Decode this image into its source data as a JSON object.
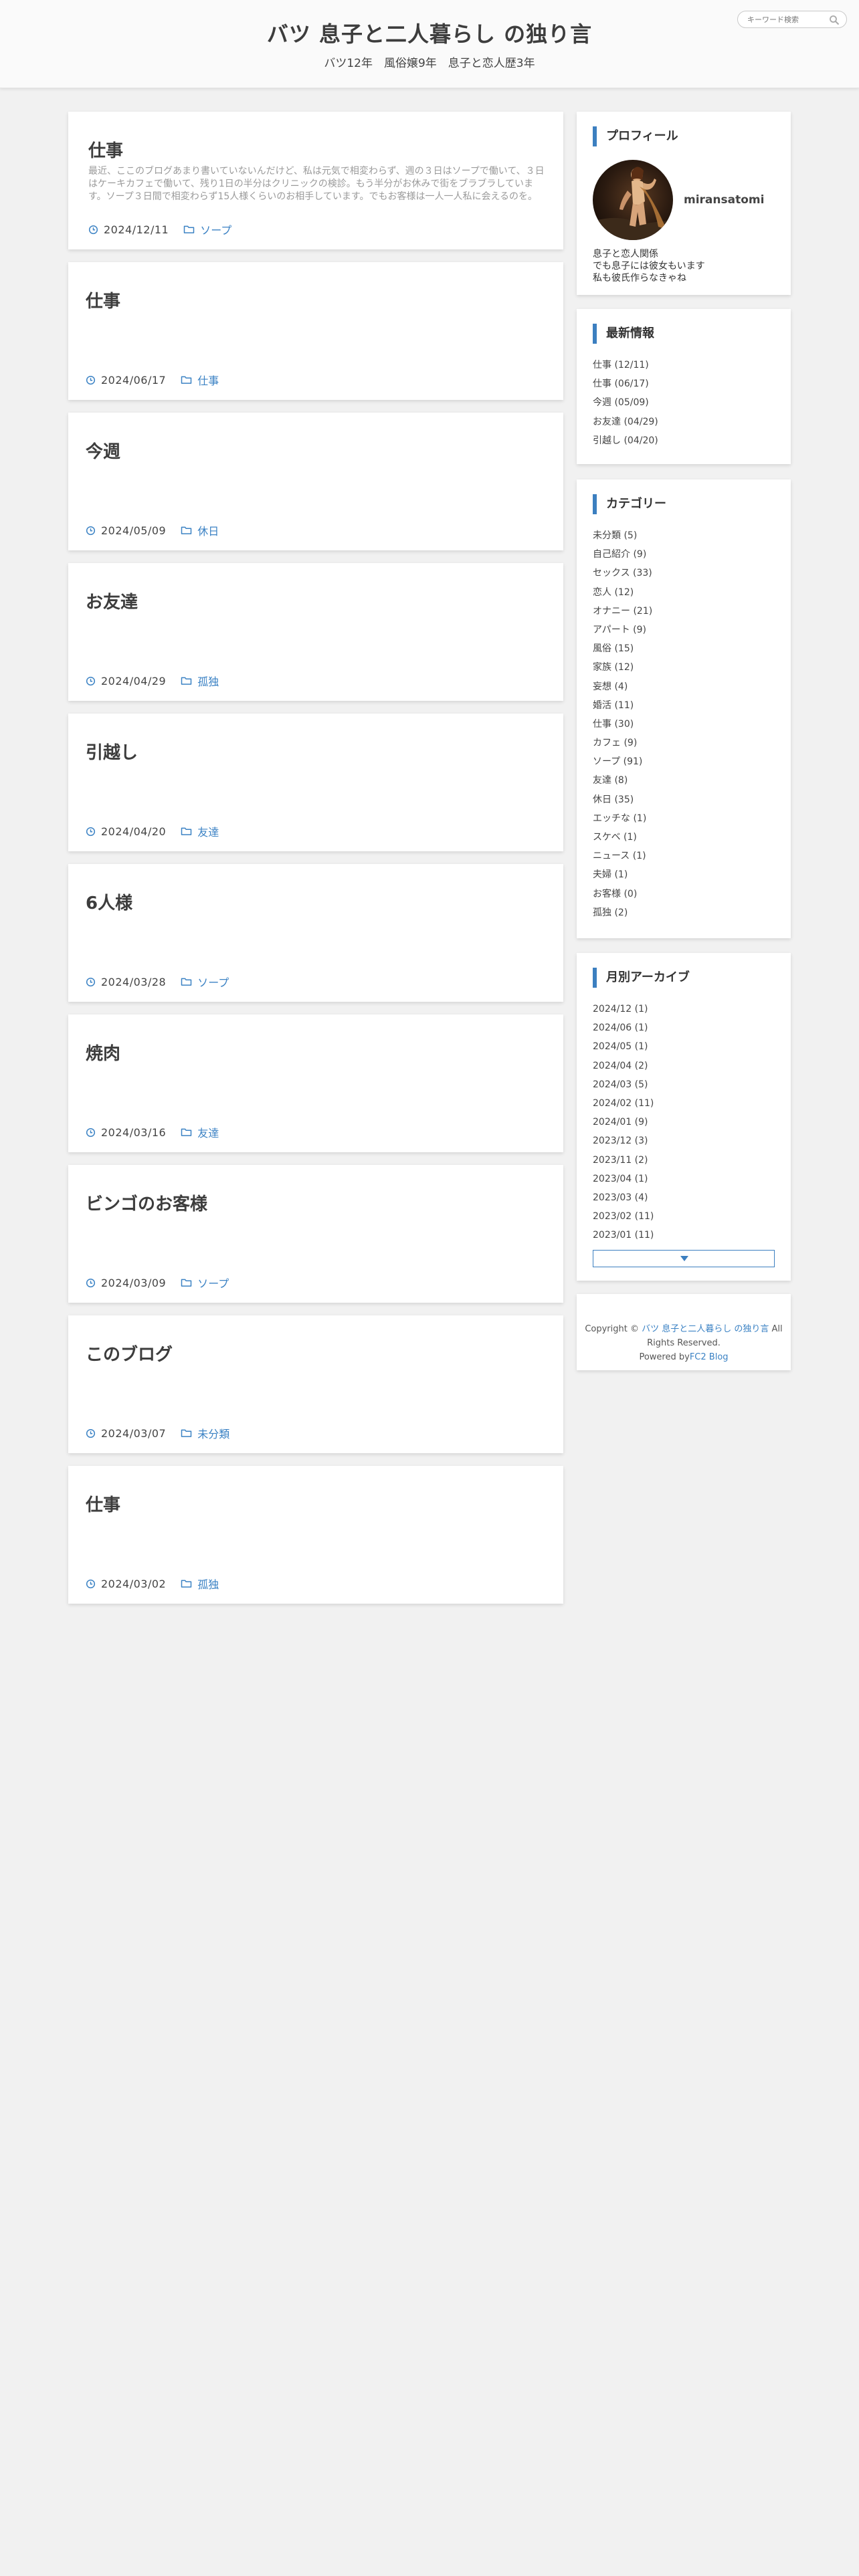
{
  "site": {
    "title": "バツ 息子と二人暮らし の独り言",
    "description": "バツ12年　風俗嬢9年　息子と恋人歴3年"
  },
  "search": {
    "placeholder": "キーワード検索"
  },
  "posts": [
    {
      "title": "仕事",
      "excerpt": "最近、ここのブログあまり書いていないんだけど、私は元気で相変わらず、週の３日はソープで働いて、３日はケーキカフェで働いて、残り1日の半分はクリニックの検診。もう半分がお休みで街をブラブラしています。ソープ３日間で相変わらず15人様くらいのお相手しています。でもお客様は一人一人私に会えるのを。",
      "date": "2024/12/11",
      "category": "ソープ"
    },
    {
      "title": "仕事",
      "excerpt": "",
      "date": "2024/06/17",
      "category": "仕事"
    },
    {
      "title": "今週",
      "excerpt": "",
      "date": "2024/05/09",
      "category": "休日"
    },
    {
      "title": "お友達",
      "excerpt": "",
      "date": "2024/04/29",
      "category": "孤独"
    },
    {
      "title": "引越し",
      "excerpt": "",
      "date": "2024/04/20",
      "category": "友達"
    },
    {
      "title": "6人様",
      "excerpt": "",
      "date": "2024/03/28",
      "category": "ソープ"
    },
    {
      "title": "焼肉",
      "excerpt": "",
      "date": "2024/03/16",
      "category": "友達"
    },
    {
      "title": "ビンゴのお客様",
      "excerpt": "",
      "date": "2024/03/09",
      "category": "ソープ"
    },
    {
      "title": "このブログ",
      "excerpt": "",
      "date": "2024/03/07",
      "category": "未分類"
    },
    {
      "title": "仕事",
      "excerpt": "",
      "date": "2024/03/02",
      "category": "孤独"
    }
  ],
  "sidebar": {
    "profile": {
      "title": "プロフィール",
      "name": "miransatomi",
      "bio": [
        "息子と恋人関係",
        "でも息子には彼女もいます",
        "私も彼氏作らなきゃね"
      ]
    },
    "recent": {
      "title": "最新情報",
      "items": [
        "仕事 (12/11)",
        "仕事 (06/17)",
        "今週 (05/09)",
        "お友達 (04/29)",
        "引越し (04/20)"
      ]
    },
    "categories": {
      "title": "カテゴリー",
      "items": [
        "未分類 (5)",
        "自己紹介 (9)",
        "セックス (33)",
        "恋人 (12)",
        "オナニー (21)",
        "アパート (9)",
        "風俗 (15)",
        "家族 (12)",
        "妄想 (4)",
        "婚活 (11)",
        "仕事 (30)",
        "カフェ (9)",
        "ソープ (91)",
        "友達 (8)",
        "休日 (35)",
        "エッチな (1)",
        "スケベ (1)",
        "ニュース (1)",
        "夫婦 (1)",
        "お客様 (0)",
        "孤独 (2)"
      ]
    },
    "archive": {
      "title": "月別アーカイブ",
      "items": [
        "2024/12 (1)",
        "2024/06 (1)",
        "2024/05 (1)",
        "2024/04 (2)",
        "2024/03 (5)",
        "2024/02 (11)",
        "2024/01 (9)",
        "2023/12 (3)",
        "2023/11 (2)",
        "2023/04 (1)",
        "2023/03 (4)",
        "2023/02 (11)",
        "2023/01 (11)"
      ]
    },
    "footer": {
      "copyright_prefix": "Copyright ©",
      "site_link": "バツ 息子と二人暮らし の独り言",
      "rights": "All Rights Reserved.",
      "powered_by": "Powered by",
      "fc2_link": "FC2 Blog"
    }
  },
  "colors": {
    "accent": "#3c7fc0",
    "link": "#3b82c4",
    "background": "#f1f1f1"
  }
}
